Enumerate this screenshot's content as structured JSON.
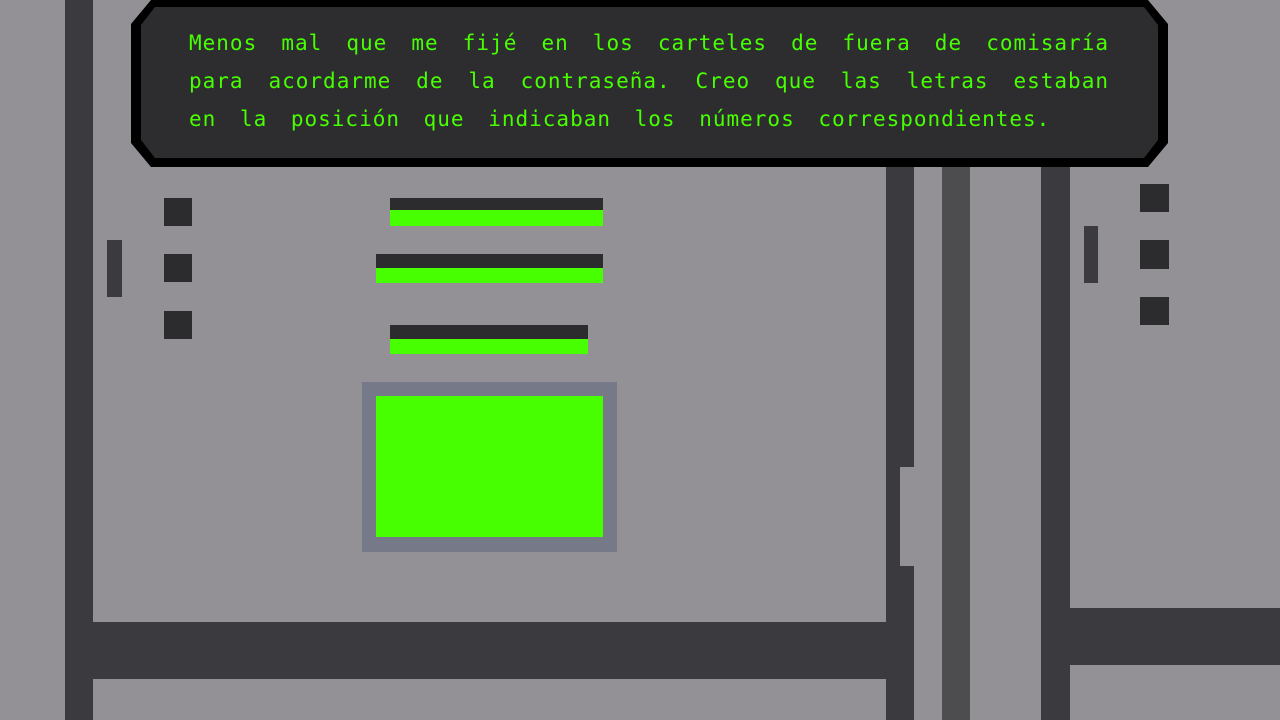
{
  "dialogue": {
    "text": "Menos mal que me fijé en los carteles de fuera de comisaría para acordarme de la contraseña. Creo que las letras estaban en la posición que indicaban los números correspondientes."
  },
  "colors": {
    "accent": "#47ff00",
    "wall": "#939195",
    "dark": "#3b3a3e",
    "panel": "#2d2d2f",
    "screen_frame": "#767a88"
  },
  "password_fields": [
    {
      "name": "password-slot-1"
    },
    {
      "name": "password-slot-2"
    },
    {
      "name": "password-slot-3"
    }
  ]
}
